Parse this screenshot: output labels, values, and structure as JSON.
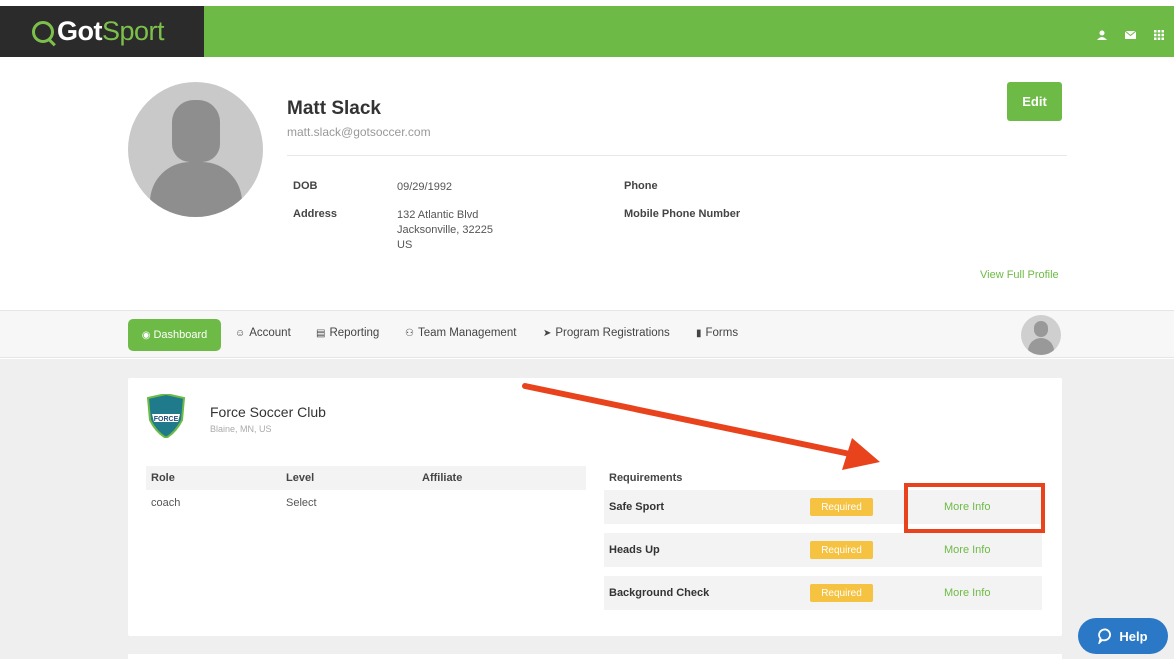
{
  "header": {
    "brand_got": "Got",
    "brand_sport": "Sport",
    "icons": [
      "user-icon",
      "mail-icon",
      "grid-icon"
    ]
  },
  "profile": {
    "name": "Matt Slack",
    "email": "matt.slack@gotsoccer.com",
    "dob_label": "DOB",
    "dob": "09/29/1992",
    "address_label": "Address",
    "address_line1": "132 Atlantic Blvd",
    "address_line2": "Jacksonville, 32225",
    "address_line3": "US",
    "phone_label": "Phone",
    "mobile_label": "Mobile Phone Number",
    "edit_label": "Edit",
    "view_full_label": "View Full Profile"
  },
  "nav": {
    "items": [
      {
        "label": "Dashboard",
        "icon": "dashboard-icon",
        "active": true
      },
      {
        "label": "Account",
        "icon": "account-icon"
      },
      {
        "label": "Reporting",
        "icon": "reporting-icon"
      },
      {
        "label": "Team Management",
        "icon": "team-icon"
      },
      {
        "label": "Program Registrations",
        "icon": "paper-plane-icon"
      },
      {
        "label": "Forms",
        "icon": "file-icon"
      }
    ]
  },
  "club": {
    "name": "Force Soccer Club",
    "location": "Blaine, MN, US",
    "logo_text": "FORCE"
  },
  "roles_table": {
    "headers": [
      "Role",
      "Level",
      "Affiliate"
    ],
    "rows": [
      [
        "coach",
        "Select",
        ""
      ]
    ]
  },
  "requirements": {
    "title": "Requirements",
    "items": [
      {
        "name": "Safe Sport",
        "status": "Required",
        "link": "More Info"
      },
      {
        "name": "Heads Up",
        "status": "Required",
        "link": "More Info"
      },
      {
        "name": "Background Check",
        "status": "Required",
        "link": "More Info"
      }
    ]
  },
  "help": {
    "label": "Help"
  },
  "colors": {
    "brand_green": "#6dbb46",
    "badge_yellow": "#f5c242",
    "annotation_red": "#e8431c",
    "help_blue": "#2b78c6"
  }
}
